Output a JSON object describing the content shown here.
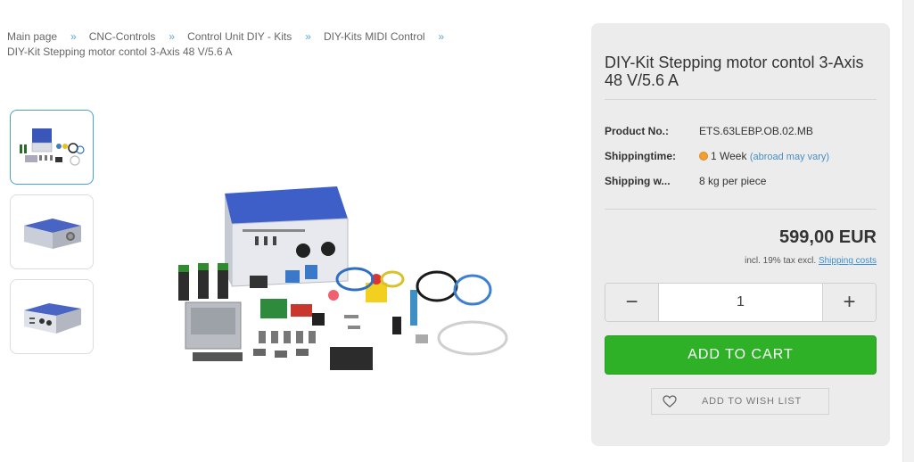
{
  "breadcrumb": {
    "items": [
      "Main page",
      "CNC-Controls",
      "Control Unit DIY - Kits",
      "DIY-Kits MIDI Control"
    ],
    "separator": "»",
    "current": "DIY-Kit Stepping motor contol 3-Axis 48 V/5.6 A"
  },
  "product": {
    "title": "DIY-Kit Stepping motor contol 3-Axis 48 V/5.6 A",
    "properties": [
      {
        "label": "Product No.:",
        "value": "ETS.63LEBP.OB.02.MB"
      },
      {
        "label": "Shippingtime:",
        "value": "1 Week",
        "note": "(abroad may vary)"
      },
      {
        "label": "Shipping w...",
        "value": "8 kg per piece"
      }
    ],
    "price": "599,00 EUR",
    "tax_text": "incl. 19% tax excl.",
    "shipping_link": "Shipping costs"
  },
  "cart": {
    "quantity": "1",
    "minus": "−",
    "plus": "+",
    "add_to_cart": "ADD TO CART",
    "wish_list": "ADD TO WISH LIST"
  },
  "colors": {
    "accent": "#2eb027",
    "link": "#3b8fd0",
    "shipping_dot": "#f0a030",
    "panel_bg": "#ececec",
    "enclosure_blue": "#3a56b8"
  },
  "icons": [
    "heart-icon",
    "availability-dot-icon"
  ]
}
